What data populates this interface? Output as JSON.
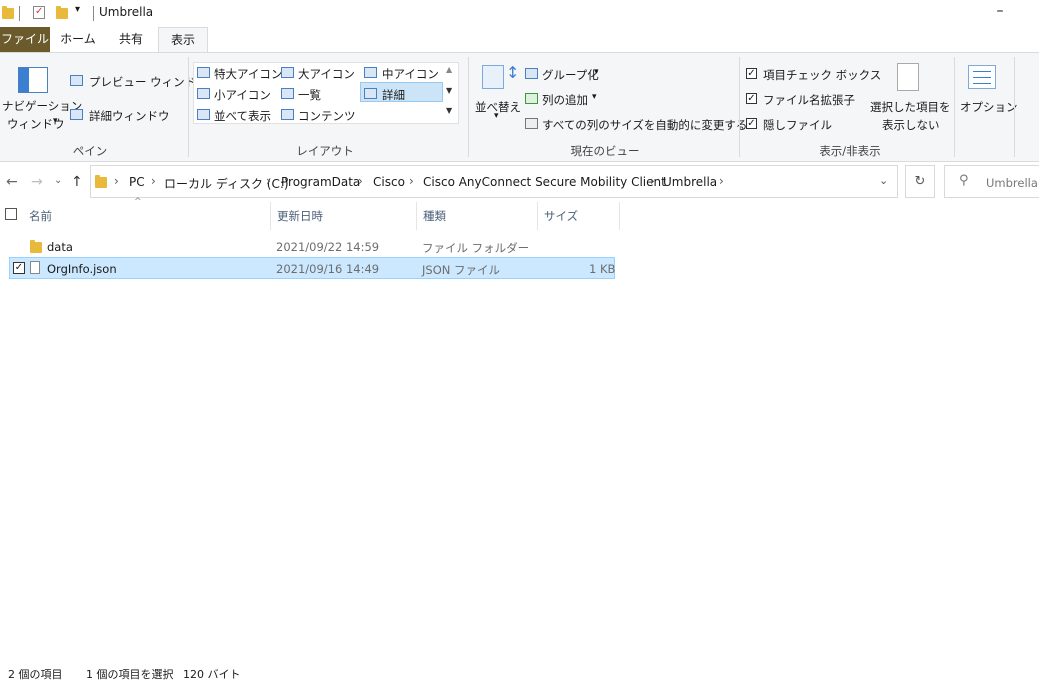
{
  "window": {
    "title": "Umbrella"
  },
  "tabs": {
    "file": "ファイル",
    "home": "ホーム",
    "share": "共有",
    "view": "表示"
  },
  "ribbon": {
    "pane": {
      "nav_pane_line1": "ナビゲーション",
      "nav_pane_line2": "ウィンドウ",
      "preview_pane": "プレビュー ウィンドウ",
      "details_pane": "詳細ウィンドウ",
      "label": "ペイン"
    },
    "layout": {
      "xl_icons": "特大アイコン",
      "large_icons": "大アイコン",
      "medium_icons": "中アイコン",
      "small_icons": "小アイコン",
      "list": "一覧",
      "details": "詳細",
      "tiles": "並べて表示",
      "content": "コンテンツ",
      "label": "レイアウト"
    },
    "current_view": {
      "sort_by": "並べ替え",
      "group_by": "グループ化",
      "add_columns": "列の追加",
      "size_all_columns": "すべての列のサイズを自動的に変更する",
      "label": "現在のビュー"
    },
    "show_hide": {
      "item_checkboxes": "項目チェック ボックス",
      "file_extensions": "ファイル名拡張子",
      "hidden_items": "隠しファイル",
      "hide_selected_line1": "選択した項目を",
      "hide_selected_line2": "表示しない",
      "label": "表示/非表示",
      "item_checkboxes_checked": true,
      "file_extensions_checked": true,
      "hidden_items_checked": true
    },
    "options": {
      "label": "オプション"
    }
  },
  "address": {
    "breadcrumbs": [
      "PC",
      "ローカル ディスク (C:)",
      "ProgramData",
      "Cisco",
      "Cisco AnyConnect Secure Mobility Client",
      "Umbrella"
    ],
    "search_placeholder": "Umbrellaの"
  },
  "columns": {
    "name": "名前",
    "modified": "更新日時",
    "type": "種類",
    "size": "サイズ"
  },
  "files": [
    {
      "name": "data",
      "modified": "2021/09/22 14:59",
      "type": "ファイル フォルダー",
      "size": "",
      "selected": false
    },
    {
      "name": "OrgInfo.json",
      "modified": "2021/09/16 14:49",
      "type": "JSON ファイル",
      "size": "1 KB",
      "selected": true
    }
  ],
  "status": {
    "item_count": "2 個の項目",
    "selection": "1 個の項目を選択",
    "selection_size": "120 バイト"
  },
  "colors": {
    "file_tab": "#6b5a2c",
    "selection_bg": "#cce8ff",
    "selection_border": "#99d1ff",
    "folder": "#e8b93a"
  }
}
